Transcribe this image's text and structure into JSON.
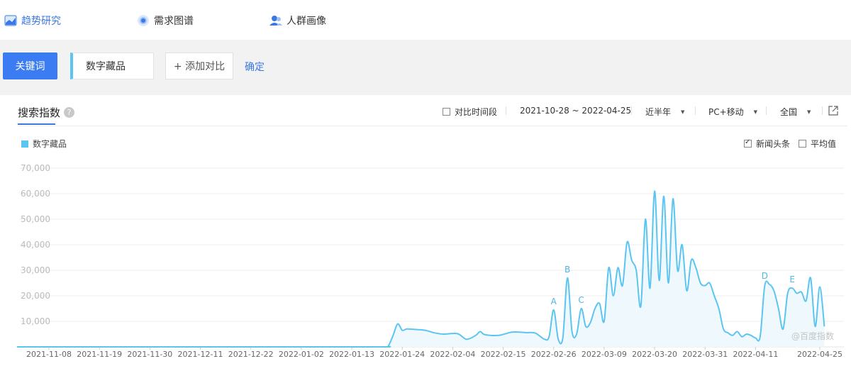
{
  "nav": {
    "items": [
      {
        "label": "趋势研究",
        "icon": "trend-chart-icon",
        "active": true
      },
      {
        "label": "需求图谱",
        "icon": "target-icon",
        "active": false
      },
      {
        "label": "人群画像",
        "icon": "people-icon",
        "active": false
      }
    ]
  },
  "search": {
    "keyword_button": "关键词",
    "keyword_value": "数字藏品",
    "add_compare": "+ 添加对比",
    "confirm": "确定"
  },
  "panel": {
    "title": "搜索指数",
    "help": "?",
    "compare_period": "对比时间段",
    "date_range": "2021-10-28 ~ 2022-04-25",
    "period": "近半年",
    "device": "PC+移动",
    "region": "全国",
    "legend": "数字藏品",
    "news_headlines": "新闻头条",
    "average": "平均值",
    "watermark": "@百度指数"
  },
  "colors": {
    "accent": "#3b78e7",
    "series": "#5bc5f2",
    "fill": "#eef8fd"
  },
  "chart_data": {
    "type": "area",
    "series": [
      {
        "name": "数字藏品"
      }
    ],
    "ylim": [
      0,
      70000
    ],
    "yticks": [
      10000,
      20000,
      30000,
      40000,
      50000,
      60000,
      70000
    ],
    "ytick_labels": [
      "10,000",
      "20,000",
      "30,000",
      "40,000",
      "50,000",
      "60,000",
      "70,000"
    ],
    "xtick_labels": [
      "2021-11-08",
      "2021-11-19",
      "2021-11-30",
      "2021-12-11",
      "2021-12-22",
      "2022-01-02",
      "2022-01-13",
      "2022-01-24",
      "2022-02-04",
      "2022-02-15",
      "2022-02-26",
      "2022-03-09",
      "2022-03-20",
      "2022-03-31",
      "2022-04-11",
      "2022-04-25"
    ],
    "points": [
      [
        "2021-10-28",
        0
      ],
      [
        "2021-11-15",
        0
      ],
      [
        "2021-12-15",
        0
      ],
      [
        "2022-01-05",
        0
      ],
      [
        "2022-01-20",
        0
      ],
      [
        "2022-01-21",
        500
      ],
      [
        "2022-01-22",
        4500
      ],
      [
        "2022-01-23",
        9000
      ],
      [
        "2022-01-24",
        6500
      ],
      [
        "2022-01-25",
        7000
      ],
      [
        "2022-01-27",
        6800
      ],
      [
        "2022-01-29",
        6500
      ],
      [
        "2022-01-31",
        5500
      ],
      [
        "2022-02-02",
        5000
      ],
      [
        "2022-02-05",
        5200
      ],
      [
        "2022-02-07",
        3000
      ],
      [
        "2022-02-09",
        4500
      ],
      [
        "2022-02-10",
        6000
      ],
      [
        "2022-02-11",
        4800
      ],
      [
        "2022-02-14",
        4500
      ],
      [
        "2022-02-17",
        5800
      ],
      [
        "2022-02-20",
        5600
      ],
      [
        "2022-02-22",
        5400
      ],
      [
        "2022-02-24",
        3000
      ],
      [
        "2022-02-25",
        4000
      ],
      [
        "2022-02-26",
        14500
      ],
      [
        "2022-02-27",
        3000
      ],
      [
        "2022-02-28",
        3500
      ],
      [
        "2022-03-01",
        27000
      ],
      [
        "2022-03-02",
        6000
      ],
      [
        "2022-03-03",
        5000
      ],
      [
        "2022-03-04",
        15000
      ],
      [
        "2022-03-05",
        8000
      ],
      [
        "2022-03-06",
        9500
      ],
      [
        "2022-03-07",
        15000
      ],
      [
        "2022-03-08",
        17000
      ],
      [
        "2022-03-09",
        10000
      ],
      [
        "2022-03-10",
        31000
      ],
      [
        "2022-03-11",
        20000
      ],
      [
        "2022-03-12",
        31000
      ],
      [
        "2022-03-13",
        24000
      ],
      [
        "2022-03-14",
        41000
      ],
      [
        "2022-03-15",
        34000
      ],
      [
        "2022-03-16",
        30000
      ],
      [
        "2022-03-17",
        16000
      ],
      [
        "2022-03-18",
        50000
      ],
      [
        "2022-03-19",
        23000
      ],
      [
        "2022-03-20",
        61000
      ],
      [
        "2022-03-21",
        26000
      ],
      [
        "2022-03-22",
        59000
      ],
      [
        "2022-03-23",
        25000
      ],
      [
        "2022-03-24",
        58000
      ],
      [
        "2022-03-25",
        30000
      ],
      [
        "2022-03-26",
        40000
      ],
      [
        "2022-03-27",
        22000
      ],
      [
        "2022-03-28",
        34000
      ],
      [
        "2022-03-29",
        31000
      ],
      [
        "2022-03-30",
        25000
      ],
      [
        "2022-03-31",
        24000
      ],
      [
        "2022-04-01",
        25000
      ],
      [
        "2022-04-02",
        20000
      ],
      [
        "2022-04-03",
        15000
      ],
      [
        "2022-04-04",
        7000
      ],
      [
        "2022-04-05",
        5500
      ],
      [
        "2022-04-06",
        4500
      ],
      [
        "2022-04-07",
        6000
      ],
      [
        "2022-04-08",
        4000
      ],
      [
        "2022-04-09",
        5000
      ],
      [
        "2022-04-10",
        4500
      ],
      [
        "2022-04-11",
        3500
      ],
      [
        "2022-04-12",
        4000
      ],
      [
        "2022-04-13",
        24000
      ],
      [
        "2022-04-14",
        24500
      ],
      [
        "2022-04-15",
        22000
      ],
      [
        "2022-04-16",
        15000
      ],
      [
        "2022-04-17",
        7000
      ],
      [
        "2022-04-18",
        21000
      ],
      [
        "2022-04-19",
        23000
      ],
      [
        "2022-04-20",
        21000
      ],
      [
        "2022-04-21",
        21500
      ],
      [
        "2022-04-22",
        18000
      ],
      [
        "2022-04-23",
        27000
      ],
      [
        "2022-04-24",
        8000
      ],
      [
        "2022-04-25",
        23500
      ],
      [
        "2022-04-26",
        8000
      ]
    ],
    "annotations": [
      {
        "label": "A",
        "date": "2022-02-26",
        "value": 14500
      },
      {
        "label": "B",
        "date": "2022-03-01",
        "value": 27000
      },
      {
        "label": "C",
        "date": "2022-03-04",
        "value": 15000
      },
      {
        "label": "D",
        "date": "2022-04-13",
        "value": 24500
      },
      {
        "label": "E",
        "date": "2022-04-19",
        "value": 23000
      }
    ]
  }
}
